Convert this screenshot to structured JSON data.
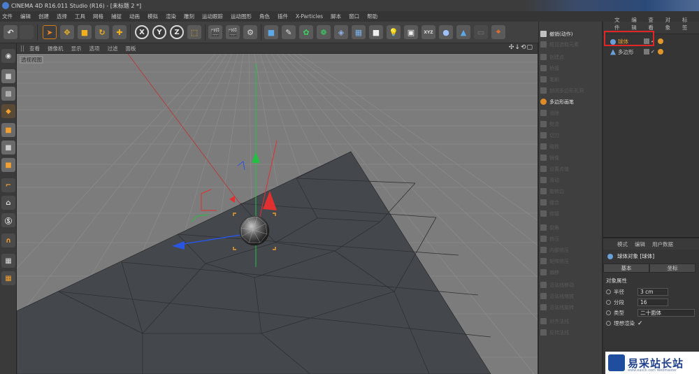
{
  "window": {
    "title": "CINEMA 4D R16.011 Studio (R16) - [未标题 2 *]"
  },
  "menu": [
    "文件",
    "编辑",
    "创建",
    "选择",
    "工具",
    "网格",
    "捕捉",
    "动画",
    "模拟",
    "渲染",
    "雕刻",
    "运动跟踪",
    "运动图形",
    "角色",
    "插件",
    "X-Particles",
    "脚本",
    "窗口",
    "帮助"
  ],
  "toolbar": {
    "axis_x": "X",
    "axis_y": "Y",
    "axis_z": "Z"
  },
  "viewport": {
    "menu": [
      "查看",
      "摄像机",
      "显示",
      "选项",
      "过滤",
      "面板"
    ],
    "label": "透视视图",
    "nav_icons": "✣↓⟲▢"
  },
  "commands": [
    {
      "label": "撤销(动作)",
      "active": true
    },
    {
      "label": "框显选取元素",
      "active": false
    },
    {
      "label": "创建点",
      "active": false
    },
    {
      "label": "桥接",
      "active": false
    },
    {
      "label": "笔刷",
      "active": false
    },
    {
      "label": "封闭多边形孔洞",
      "active": false
    },
    {
      "label": "多边形画笔",
      "active": true,
      "accent": true
    },
    {
      "label": "消除",
      "active": false
    },
    {
      "label": "熨烫",
      "active": false
    },
    {
      "label": "切刀",
      "active": false
    },
    {
      "label": "磁铁",
      "active": false
    },
    {
      "label": "镜像",
      "active": false
    },
    {
      "label": "设置点值",
      "active": false
    },
    {
      "label": "滑动",
      "active": false
    },
    {
      "label": "旋转边",
      "active": false
    },
    {
      "label": "缝合",
      "active": false
    },
    {
      "label": "焊接",
      "active": false
    },
    {
      "label": "倒角",
      "active": false
    },
    {
      "label": "挤压",
      "active": false
    },
    {
      "label": "内部挤压",
      "active": false
    },
    {
      "label": "矩阵挤压",
      "active": false
    },
    {
      "label": "偏移",
      "active": false
    },
    {
      "label": "沿法线移动",
      "active": false
    },
    {
      "label": "沿法线缩放",
      "active": false
    },
    {
      "label": "沿法线旋转",
      "active": false
    },
    {
      "label": "对齐法线",
      "active": false
    },
    {
      "label": "反转法线",
      "active": false
    }
  ],
  "object_manager": {
    "tabs": [
      "文件",
      "编辑",
      "查看",
      "对象",
      "标签"
    ],
    "objects": [
      {
        "name": "球体",
        "color": "#f0a030",
        "icon_color": "#6aa0d8"
      },
      {
        "name": "多边形",
        "color": "#c8c8c8",
        "icon_color": "#6aa0d8"
      }
    ]
  },
  "attribute_manager": {
    "tabs": [
      "模式",
      "编辑",
      "用户数据"
    ],
    "title": "球体对象 [球体]",
    "subtabs": [
      "基本",
      "坐标"
    ],
    "section": "对象属性",
    "rows": [
      {
        "label": "半径",
        "value": "3 cm"
      },
      {
        "label": "分段",
        "value": "16"
      },
      {
        "label": "类型",
        "value": "二十面体"
      },
      {
        "label": "理想渲染",
        "value": "✓"
      }
    ]
  },
  "watermark": {
    "cn": "易采站长站",
    "en": "www.easck.com Webmaster"
  },
  "colors": {
    "axis_x": "#e03030",
    "axis_y": "#22c040",
    "axis_z": "#2a55e0",
    "highlight": "#e22525",
    "plane": "#44484c"
  }
}
